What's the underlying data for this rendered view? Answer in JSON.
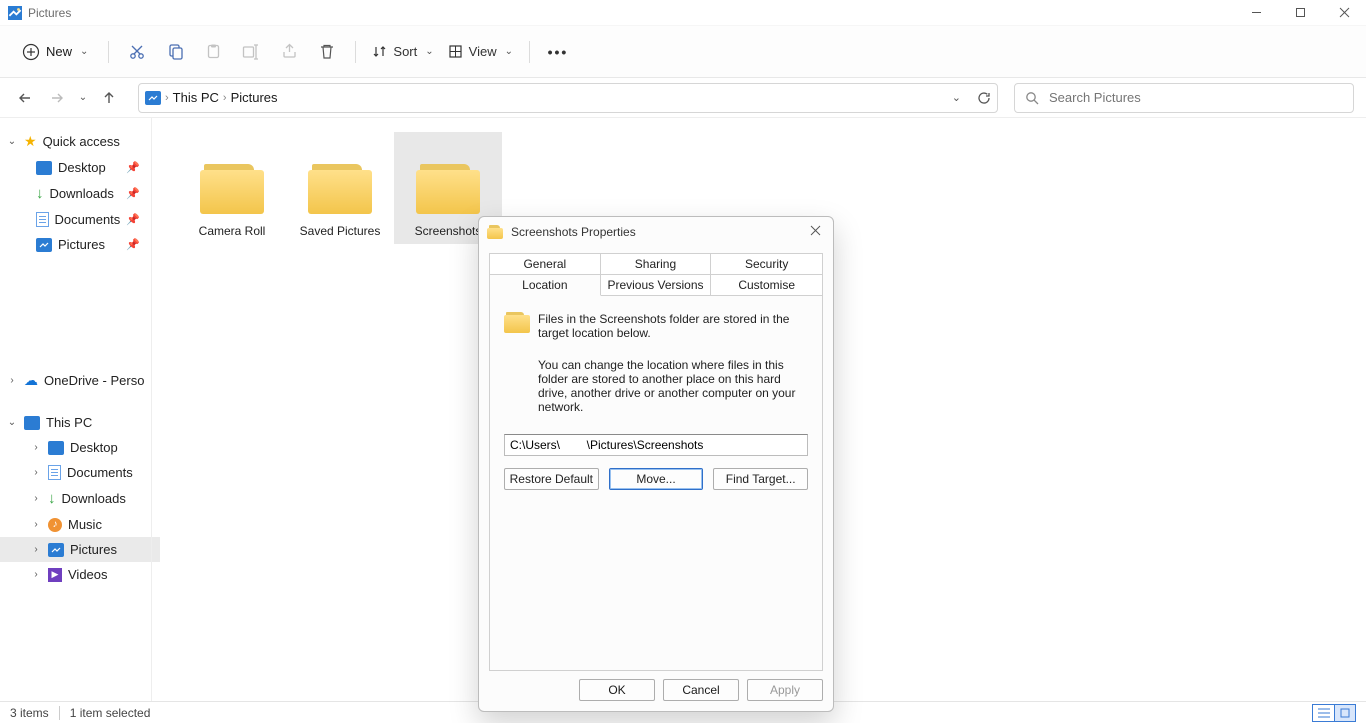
{
  "titlebar": {
    "title": "Pictures"
  },
  "toolbar": {
    "new_label": "New",
    "sort_label": "Sort",
    "view_label": "View"
  },
  "breadcrumb": {
    "seg1": "This PC",
    "seg2": "Pictures"
  },
  "search": {
    "placeholder": "Search Pictures"
  },
  "sidebar": {
    "quick_access": "Quick access",
    "desktop": "Desktop",
    "downloads": "Downloads",
    "documents": "Documents",
    "pictures": "Pictures",
    "onedrive": "OneDrive - Perso",
    "this_pc": "This PC",
    "pc_desktop": "Desktop",
    "pc_documents": "Documents",
    "pc_downloads": "Downloads",
    "pc_music": "Music",
    "pc_pictures": "Pictures",
    "pc_videos": "Videos"
  },
  "folders": {
    "f1": "Camera Roll",
    "f2": "Saved Pictures",
    "f3": "Screenshots"
  },
  "statusbar": {
    "items": "3 items",
    "selected": "1 item selected"
  },
  "dialog": {
    "title": "Screenshots Properties",
    "tabs": {
      "general": "General",
      "sharing": "Sharing",
      "security": "Security",
      "location": "Location",
      "previous": "Previous Versions",
      "customise": "Customise"
    },
    "body": {
      "line1": "Files in the Screenshots folder are stored in the target location below.",
      "line2": "You can change the location where files in this folder are stored to another place on this hard drive, another drive or another computer on your network.",
      "path": "C:\\Users\\        \\Pictures\\Screenshots",
      "restore": "Restore Default",
      "move": "Move...",
      "find": "Find Target..."
    },
    "footer": {
      "ok": "OK",
      "cancel": "Cancel",
      "apply": "Apply"
    }
  }
}
